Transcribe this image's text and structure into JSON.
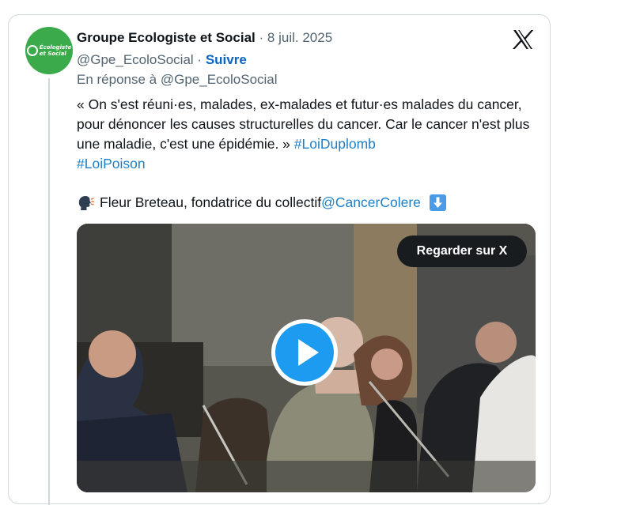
{
  "tweet": {
    "author_name": "Groupe Ecologiste et Social",
    "separator": "·",
    "date": "8 juil. 2025",
    "handle": "@Gpe_EcoloSocial",
    "follow_label": "Suivre",
    "reply_prefix": "En réponse à ",
    "reply_handle": "@Gpe_EcoloSocial",
    "avatar_text_line1": "Écologiste",
    "avatar_text_line2": "et Social",
    "body_text": "« On s'est réuni·es, malades, ex-malades et futur·es malades du cancer, pour dénoncer les causes structurelles du cancer. Car le cancer n'est plus une maladie, c'est une épidémie. » ",
    "hashtags": [
      "#LoiDuplomb",
      "#LoiPoison"
    ],
    "signature_text": "Fleur Breteau, fondatrice du collectif ",
    "signature_mention": "@CancerColere",
    "media": {
      "watch_label": "Regarder sur X"
    }
  },
  "icons": {
    "x_logo": "x-logo-icon",
    "speaking": "speaking-head-icon",
    "down_arrow": "down-arrow-icon",
    "play": "play-icon"
  },
  "colors": {
    "link": "#1d7fc7",
    "follow": "#0a66c2",
    "play": "#1d9bf0",
    "avatar_bg": "#3aaa4b",
    "muted": "#536471"
  }
}
